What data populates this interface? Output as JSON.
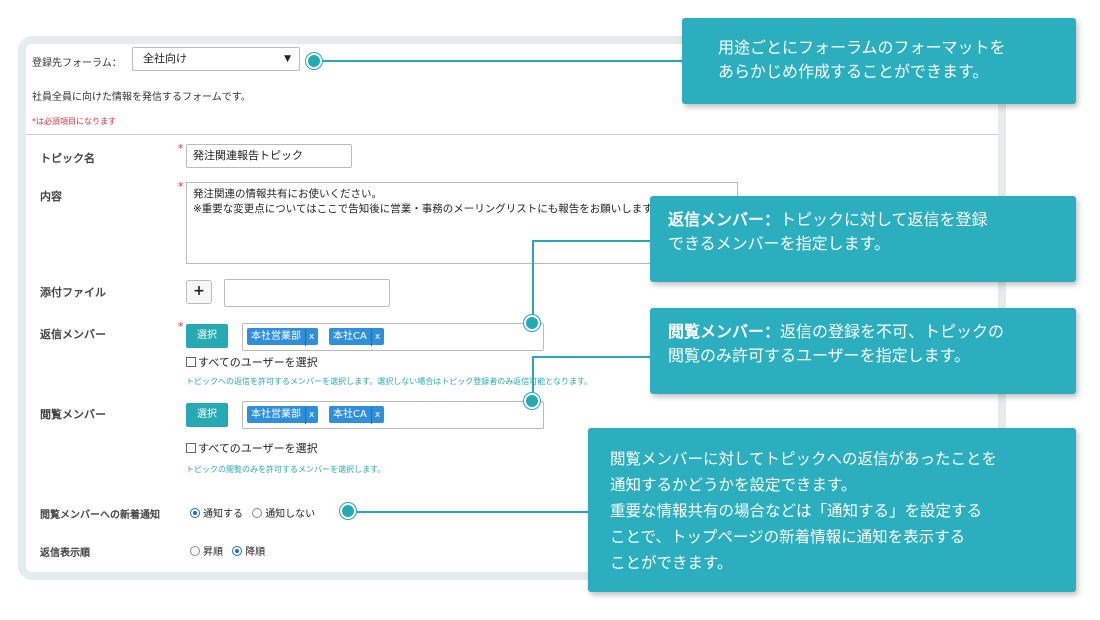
{
  "forum": {
    "label": "登録先フォーラム：",
    "selected": "全社向け",
    "description": "社員全員に向けた情報を発信するフォームです。",
    "required_note": "*は必須項目になります"
  },
  "form": {
    "required_mark": "*",
    "topic_label": "トピック名",
    "topic_value": "発注関連報告トピック",
    "content_label": "内容",
    "content_line1": "発注関連の情報共有にお使いください。",
    "content_line2": "※重要な変更点についてはここで告知後に営業・事務のメーリングリストにも報告をお願いします。",
    "attach_label": "添付ファイル",
    "attach_button": "+",
    "reply_label": "返信メンバー",
    "reply_select": "選択",
    "reply_tags": [
      "本社営業部",
      "本社CA"
    ],
    "tag_remove": "x",
    "reply_all_users": "すべてのユーザーを選択",
    "reply_hint": "トピックへの返信を許可するメンバーを選択します。選択しない場合はトピック登録者のみ返信可能となります。",
    "view_label": "閲覧メンバー",
    "view_select": "選択",
    "view_tags": [
      "本社営業部",
      "本社CA"
    ],
    "view_all_users": "すべてのユーザーを選択",
    "view_hint": "トピックの閲覧のみを許可するメンバーを選択します。",
    "notify_label": "閲覧メンバーへの新着通知",
    "notify_on": "通知する",
    "notify_off": "通知しない",
    "notify_selected": "on",
    "order_label": "返信表示順",
    "order_asc": "昇順",
    "order_desc": "降順",
    "order_selected": "desc"
  },
  "callouts": {
    "c1_line1": "用途ごとにフォーラムのフォーマットを",
    "c1_line2": "あらかじめ作成することができます。",
    "c2_title": "返信メンバー",
    "c2_colon": "：",
    "c2_text1": "トピックに対して返信を登録",
    "c2_text2": "できるメンバーを指定します。",
    "c3_title": "閲覧メンバー",
    "c3_colon": "：",
    "c3_text1": "返信の登録を不可、トピックの",
    "c3_text2": "閲覧のみ許可するユーザーを指定します。",
    "c4_line1": "閲覧メンバーに対してトピックへの返信があったことを",
    "c4_line2": "通知するかどうかを設定できます。",
    "c4_line3": "重要な情報共有の場合などは「通知する」を設定する",
    "c4_line4": "ことで、トップページの新着情報に通知を表示する",
    "c4_line5": "ことができます。"
  },
  "colors": {
    "accent": "#27a9b3",
    "callout_bg": "#2baebe",
    "tag_bg": "#2f8fd8",
    "required": "#d33333"
  }
}
